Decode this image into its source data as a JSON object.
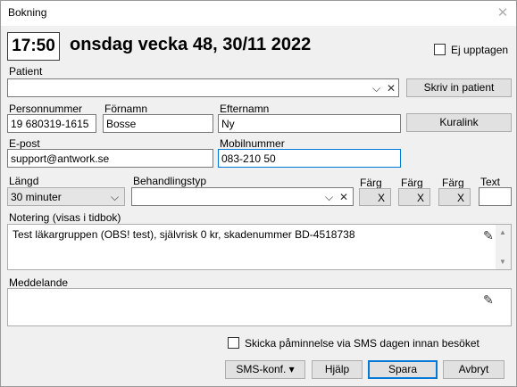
{
  "window": {
    "title": "Bokning"
  },
  "header": {
    "time": "17:50",
    "date_title": "onsdag vecka 48, 30/11 2022",
    "busy_label": "Ej upptagen"
  },
  "patient": {
    "label": "Patient",
    "value": "",
    "register_button": "Skriv in patient"
  },
  "person": {
    "pnr_label": "Personnummer",
    "pnr_value": "19 680319-1615",
    "first_label": "Förnamn",
    "first_value": "Bosse",
    "last_label": "Efternamn",
    "last_value": "Ny",
    "kuralink_button": "Kuralink"
  },
  "contact": {
    "email_label": "E-post",
    "email_value": "support@antwork.se",
    "mobile_label": "Mobilnummer",
    "mobile_value": "083-210 50"
  },
  "booking": {
    "length_label": "Längd",
    "length_value": "30 minuter",
    "treatment_label": "Behandlingstyp",
    "treatment_value": "",
    "color_label_1": "Färg",
    "color_label_2": "Färg",
    "color_label_3": "Färg",
    "clear_symbol": "X",
    "text_label": "Text",
    "text_value": ""
  },
  "notes": {
    "label": "Notering (visas i tidbok)",
    "value": "Test läkargruppen (OBS! test), självrisk 0 kr, skadenummer BD-4518738"
  },
  "message": {
    "label": "Meddelande",
    "value": ""
  },
  "sms_reminder": {
    "label": "Skicka påminnelse via SMS dagen innan besöket",
    "checked": false
  },
  "footer": {
    "sms_conf": "SMS-konf. ▾",
    "help": "Hjälp",
    "save": "Spara",
    "cancel": "Avbryt"
  },
  "colors": {
    "focus_border": "#0078d7",
    "button_bg": "#e1e1e1",
    "window_bg": "#f0f0f0"
  }
}
